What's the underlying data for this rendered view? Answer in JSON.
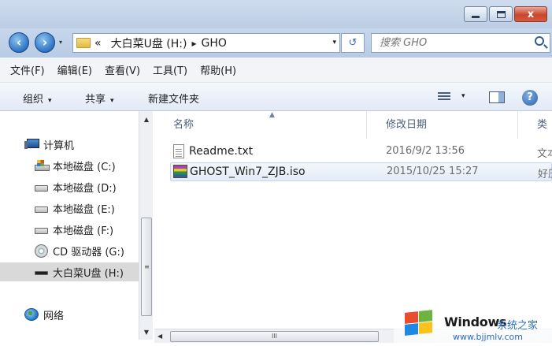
{
  "window": {
    "buttons": {
      "minimize": "minimize",
      "maximize": "maximize",
      "close": "x"
    }
  },
  "nav": {
    "back": "‹",
    "forward": "›"
  },
  "address": {
    "overflow": "«",
    "path": [
      "大白菜U盘 (H:)",
      "GHO"
    ],
    "separator": "▸",
    "dropdown": "▾",
    "refresh": "↺"
  },
  "search": {
    "placeholder": "搜索 GHO"
  },
  "menu": [
    "文件(F)",
    "编辑(E)",
    "查看(V)",
    "工具(T)",
    "帮助(H)"
  ],
  "toolbar": {
    "organize": "组织",
    "share": "共享",
    "new_folder": "新建文件夹",
    "arrow": "▾"
  },
  "navpane": {
    "computer": "计算机",
    "drives": [
      {
        "label": "本地磁盘 (C:)",
        "icon": "system-drive-icon"
      },
      {
        "label": "本地磁盘 (D:)",
        "icon": "drive-icon"
      },
      {
        "label": "本地磁盘 (E:)",
        "icon": "drive-icon"
      },
      {
        "label": "本地磁盘 (F:)",
        "icon": "drive-icon"
      },
      {
        "label": "CD 驱动器 (G:)",
        "icon": "cd-drive-icon"
      },
      {
        "label": "大白菜U盘 (H:)",
        "icon": "usb-drive-icon",
        "selected": true
      }
    ],
    "network": "网络"
  },
  "columns": {
    "name": "名称",
    "modified": "修改日期",
    "type": "类型"
  },
  "files": [
    {
      "name": "Readme.txt",
      "modified": "2016/9/2 13:56",
      "type": "文本",
      "icon": "text-file-icon"
    },
    {
      "name": "GHOST_Win7_ZJB.iso",
      "modified": "2015/10/25 15:27",
      "type": "好压",
      "icon": "iso-file-icon",
      "selected": true
    }
  ],
  "scroll": {
    "up": "▲",
    "down": "▼",
    "left": "◀",
    "grip_v": "≡",
    "grip_h": "III"
  },
  "watermark": {
    "brand": "Windows",
    "brand_cn": "系统之家",
    "url": "www.bjjmlv.com"
  },
  "colors": {
    "accent": "#2b6cc4",
    "selection": "#e4ecf7",
    "titlebar": "#c6d6ec"
  }
}
